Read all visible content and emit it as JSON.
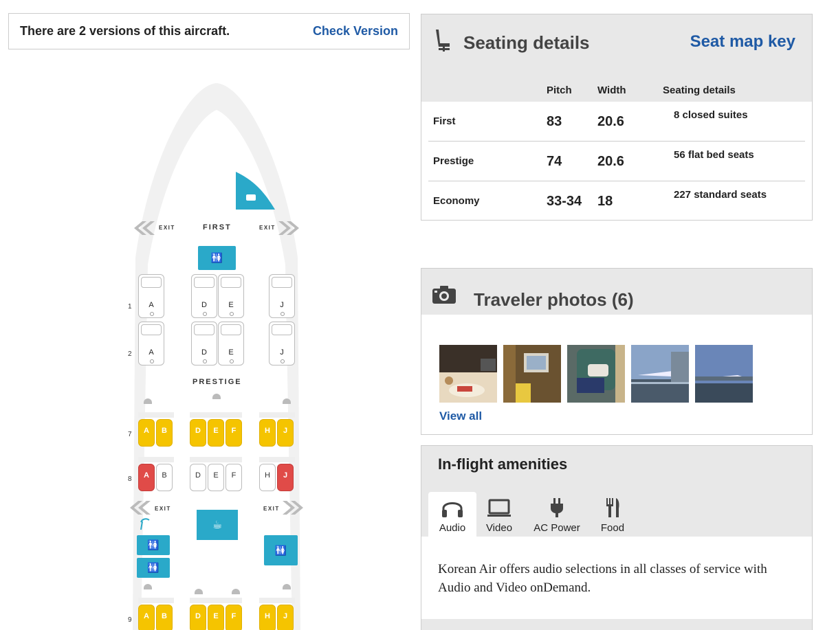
{
  "version_banner": {
    "text": "There are 2 versions of this aircraft.",
    "link": "Check Version"
  },
  "seatmap": {
    "sections": [
      "FIRST",
      "PRESTIGE"
    ],
    "exit_label": "EXIT",
    "rows": {
      "first": [
        {
          "num": "1",
          "seats": [
            "A",
            "D",
            "E",
            "J"
          ]
        },
        {
          "num": "2",
          "seats": [
            "A",
            "D",
            "E",
            "J"
          ]
        }
      ],
      "prestige": [
        {
          "num": "7",
          "seats": [
            {
              "l": "A",
              "s": "y"
            },
            {
              "l": "B",
              "s": "y"
            },
            {
              "l": "D",
              "s": "y"
            },
            {
              "l": "E",
              "s": "y"
            },
            {
              "l": "F",
              "s": "y"
            },
            {
              "l": "H",
              "s": "y"
            },
            {
              "l": "J",
              "s": "y"
            }
          ]
        },
        {
          "num": "8",
          "seats": [
            {
              "l": "A",
              "s": "r"
            },
            {
              "l": "B",
              "s": "w"
            },
            {
              "l": "D",
              "s": "w"
            },
            {
              "l": "E",
              "s": "w"
            },
            {
              "l": "F",
              "s": "w"
            },
            {
              "l": "H",
              "s": "w"
            },
            {
              "l": "J",
              "s": "r"
            }
          ]
        },
        {
          "num": "9",
          "seats": [
            {
              "l": "A",
              "s": "y"
            },
            {
              "l": "B",
              "s": "y"
            },
            {
              "l": "D",
              "s": "y"
            },
            {
              "l": "E",
              "s": "y"
            },
            {
              "l": "F",
              "s": "y"
            },
            {
              "l": "H",
              "s": "y"
            },
            {
              "l": "J",
              "s": "y"
            }
          ]
        }
      ]
    },
    "colors": {
      "preferred": "#f5c400",
      "poor": "#e04b48",
      "amenity": "#2aa9c9"
    }
  },
  "seating_details": {
    "title": "Seating details",
    "key_link": "Seat map key",
    "headers": {
      "pitch": "Pitch",
      "width": "Width",
      "details": "Seating details"
    },
    "rows": [
      {
        "class": "First",
        "pitch": "83",
        "width": "20.6",
        "details": "8 closed suites"
      },
      {
        "class": "Prestige",
        "pitch": "74",
        "width": "20.6",
        "details": "56 flat bed seats"
      },
      {
        "class": "Economy",
        "pitch": "33-34",
        "width": "18",
        "details": "227 standard seats"
      }
    ]
  },
  "photos": {
    "title": "Traveler photos (6)",
    "view_all": "View all"
  },
  "amenities": {
    "title": "In-flight amenities",
    "tabs": [
      {
        "label": "Audio",
        "icon": "headphones-icon"
      },
      {
        "label": "Video",
        "icon": "laptop-icon"
      },
      {
        "label": "AC Power",
        "icon": "plug-icon"
      },
      {
        "label": "Food",
        "icon": "fork-knife-icon"
      }
    ],
    "active_tab": "Audio",
    "description": "Korean Air offers audio selections in all classes of service with Audio and Video onDemand."
  }
}
